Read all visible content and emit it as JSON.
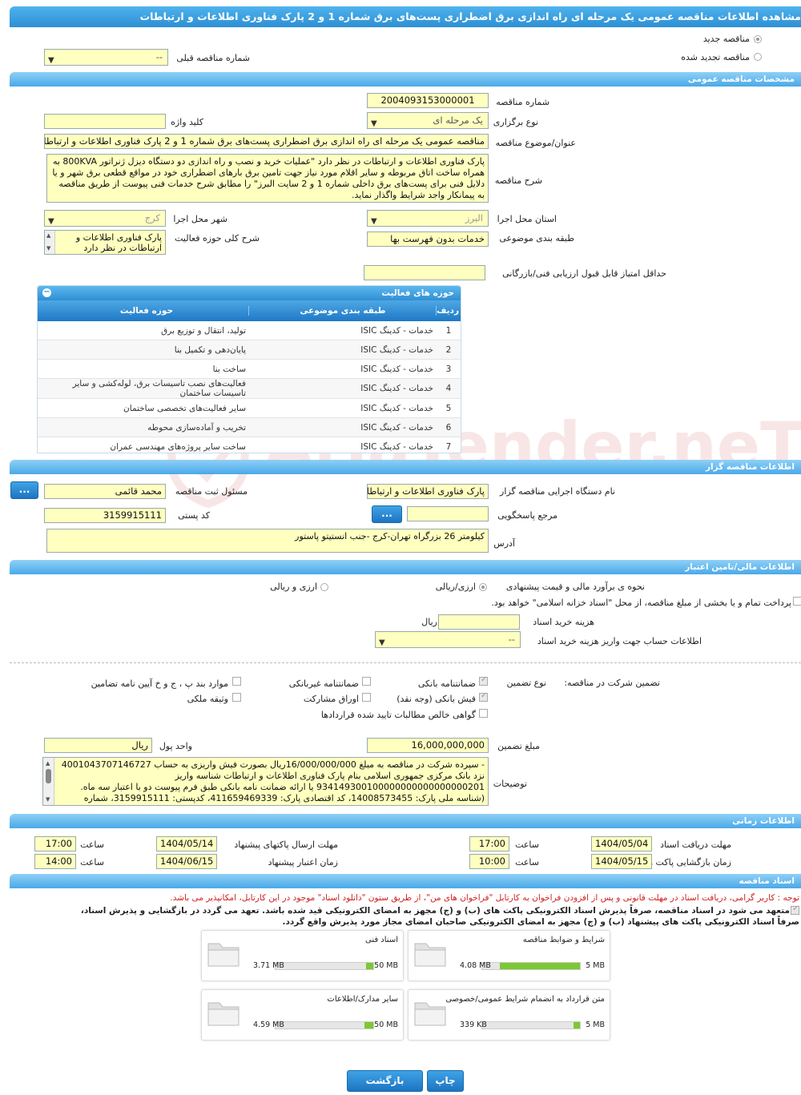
{
  "header": {
    "title": "مشاهده اطلاعات مناقصه عمومی یک مرحله ای راه اندازی برق اضطراری پست‌های برق شماره 1 و 2 پارک فناوری اطلاعات و ارتباطات"
  },
  "top": {
    "new_tender_label": "مناقصه جدید",
    "renewed_tender_label": "مناقصه تجدید شده",
    "prev_tender_label": "شماره مناقصه قبلی",
    "prev_tender_value": "--"
  },
  "general": {
    "section_title": "مشخصات مناقصه عمومی",
    "tender_number_label": "شماره مناقصه",
    "tender_number": "2004093153000001",
    "holding_type_label": "نوع برگزاری",
    "holding_type": "یک مرحله ای",
    "keyword_label": "کلید واژه",
    "keyword": "",
    "subject_label": "عنوان/موضوع مناقصه",
    "subject": "مناقصه عمومی یک مرحله ای راه اندازی برق اضطراری پست‌های برق شماره 1 و 2  پارک فناوری اطلاعات و ارتباطات",
    "description_label": "شرح مناقصه",
    "description": "پارک فناوری اطلاعات و ارتباطات در نظر دارد \"عملیات خرید و نصب و راه اندازی دو دستگاه دیزل ژنراتور 800KVA به همراه ساخت اتاق مربوطه و سایر اقلام مورد نیاز جهت تامین برق بارهای اضطراری خود در مواقع قطعی برق شهر و یا دلایل فنی برای پست‌های برق داخلی شماره 1 و 2 سایت البرز\" را مطابق شرح خدمات فنی پیوست از طریق مناقصه به پیمانکار واجد شرایط واگذار نماید.",
    "province_label": "استان محل اجرا",
    "province": "البرز",
    "city_label": "شهر محل اجرا",
    "city": "کرج",
    "category_label": "طبقه بندی موضوعی",
    "category": "خدمات بدون فهرست بها",
    "activity_desc_label": "شرح کلی حوزه فعالیت",
    "activity_desc": "پارک فناوری اطلاعات و ارتباطات در نظر دارد",
    "min_score_label": "حداقل امتیاز قابل قبول ارزیابی فنی/بازرگانی",
    "min_score": ""
  },
  "activities": {
    "panel_title": "حوزه های فعالیت",
    "col_row": "ردیف",
    "col_category": "طبقه بندی موضوعی",
    "col_field": "حوزه فعالیت",
    "rows": [
      {
        "n": "1",
        "cat": "خدمات - کدینگ ISIC",
        "field": "تولید، انتقال و توزیع برق"
      },
      {
        "n": "2",
        "cat": "خدمات - کدینگ ISIC",
        "field": "پایان‌دهی و تکمیل بنا"
      },
      {
        "n": "3",
        "cat": "خدمات - کدینگ ISIC",
        "field": "ساخت بنا"
      },
      {
        "n": "4",
        "cat": "خدمات - کدینگ ISIC",
        "field": "فعالیت‌های نصب تاسیسات برق، لوله‌کشی و سایر تاسیسات ساختمان"
      },
      {
        "n": "5",
        "cat": "خدمات - کدینگ ISIC",
        "field": "سایر فعالیت‌های تخصصی ساختمان"
      },
      {
        "n": "6",
        "cat": "خدمات - کدینگ ISIC",
        "field": "تخریب و آماده‌سازی محوطه"
      },
      {
        "n": "7",
        "cat": "خدمات - کدینگ ISIC",
        "field": "ساخت سایر پروژه‌های مهندسی عمران"
      }
    ]
  },
  "organizer": {
    "section_title": "اطلاعات مناقصه گزار",
    "org_label": "نام دستگاه اجرایی مناقصه گزار",
    "org": "پارک فناوری اطلاعات و ارتباطات",
    "officer_label": "مسئول ثبت مناقصه",
    "officer": "محمد قائمی",
    "ellipsis": "...",
    "ref_label": "مرجع پاسخگویی",
    "ref": "",
    "postal_label": "کد پستی",
    "postal": "3159915111",
    "address_label": "آدرس",
    "address": "کیلومتر 26 بزرگراه تهران-کرج -جنب انستیتو پاستور"
  },
  "finance": {
    "section_title": "اطلاعات مالی/تامین اعتبار",
    "estimate_label": "نحوه ی برآورد مالی و قیمت پیشنهادی",
    "opt_rial": "ارزی/ریالی",
    "opt_currency": "ارزی و ریالی",
    "treasury_text": "پرداخت تمام و یا بخشی از مبلغ مناقصه، از محل \"اسناد خزانه اسلامی\" خواهد بود.",
    "doc_fee_label": "هزینه خرید اسناد",
    "doc_fee": "",
    "doc_fee_unit": "ریال",
    "account_label": "اطلاعات حساب جهت واریز هزینه خرید اسناد",
    "account": "--"
  },
  "guarantee": {
    "title": "تضمین شرکت در مناقصه:",
    "type_label": "نوع تضمین",
    "opt_bank": "ضمانتنامه بانکی",
    "opt_nonbank": "ضمانتنامه غیربانکی",
    "opt_clauses": "موارد بند پ ، ج و خ آیین نامه تضامین",
    "opt_cash": "فیش بانکی (وجه نقد)",
    "opt_bonds": "اوراق مشارکت",
    "opt_property": "وثیقه ملکی",
    "opt_claims": "گواهی خالص مطالبات تایید شده قراردادها",
    "amount_label": "مبلغ تضمین",
    "amount": "16,000,000,000",
    "unit_label": "واحد پول",
    "unit": "ریال",
    "notes_label": "توضیحات",
    "notes": "- سپرده شرکت در مناقصه به مبلغ 16/000/000/000ریال بصورت فیش واریزی به حساب 4001043707146727 نزد بانک مرکزی جمهوری اسلامی بنام پارک فناوری اطلاعات و ارتباطات شناسه واریز 934149300100000000000000000201 یا ارائه ضمانت نامه بانکی طبق فرم پیوست دو با اعتبار سه ماه. (شناسه ملی پارک: 14008573455، کد اقتصادی پارک: 411659469339، کدپستی: 3159915111، شماره"
  },
  "timing": {
    "section_title": "اطلاعات زمانی",
    "receive_deadline_label": "مهلت دریافت اسناد",
    "receive_date": "1404/05/04",
    "time_label": "ساعت",
    "receive_time": "17:00",
    "send_deadline_label": "مهلت ارسال پاکتهای پیشنهاد",
    "send_date": "1404/05/14",
    "send_time": "17:00",
    "opening_label": "زمان بازگشایی پاکت ها",
    "opening_date": "1404/05/15",
    "opening_time": "10:00",
    "validity_label": "زمان اعتبار پیشنهاد",
    "validity_date": "1404/06/15",
    "validity_time": "14:00"
  },
  "docs": {
    "section_title": "اسناد مناقصه",
    "notice": "توجه : کاربر گرامی، دریافت اسناد در مهلت قانونی و پس از افزودن فراخوان به کارتابل \"فراخوان های من\"، از طریق ستون \"دانلود اسناد\" موجود در این کارتابل، امکانپذیر می باشد.",
    "commit_1": "متعهد می شود در اسناد مناقصه، صرفاً پذیرش اسناد الکترونیکی پاکت های (ب) و (ج) مجهز به امضای الکترونیکی قید شده باشد. تعهد می گردد در بازگشایی و پذیرش اسناد،",
    "commit_2": "صرفاً اسناد الکترونیکی پاکت های پیشنهاد (ب) و (ج) مجهز به امضای الکترونیکی صاحبان امضای مجاز مورد پذیرش واقع گردد.",
    "cards": [
      {
        "name": "شرایط و ضوابط مناقصه",
        "size": "4.08 MB",
        "max": "5 MB",
        "ratio": 0.816
      },
      {
        "name": "اسناد فنی",
        "size": "3.71 MB",
        "max": "50 MB",
        "ratio": 0.074
      },
      {
        "name": "متن قرارداد به انضمام شرایط عمومی/خصوصی",
        "size": "339 KB",
        "max": "5 MB",
        "ratio": 0.066
      },
      {
        "name": "سایر مدارک/اطلاعات",
        "size": "4.59 MB",
        "max": "50 MB",
        "ratio": 0.092
      }
    ]
  },
  "footer": {
    "print": "چاپ",
    "back": "بازگشت"
  }
}
